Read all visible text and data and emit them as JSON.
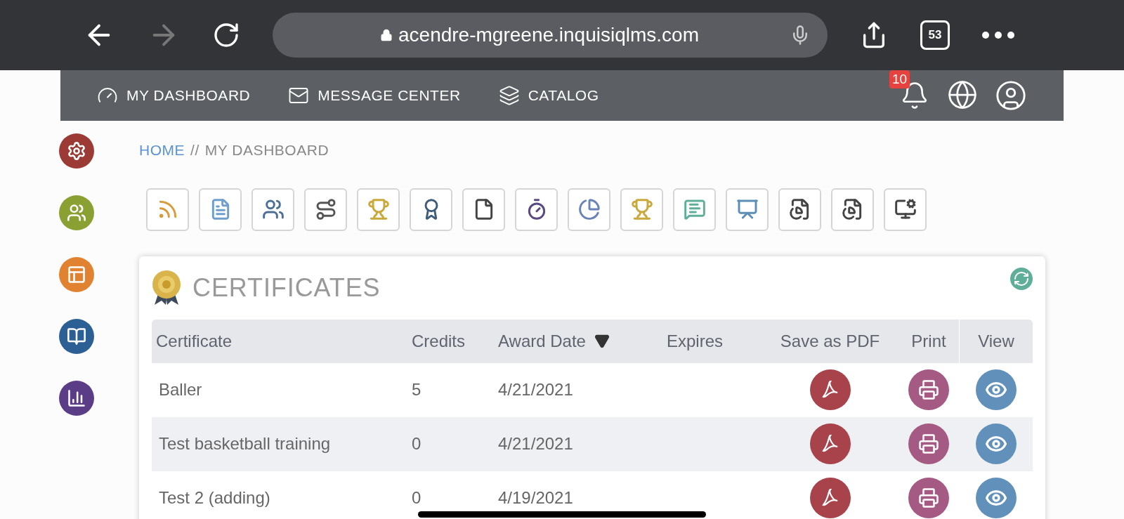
{
  "browser": {
    "url": "acendre-mgreene.inquisiqlms.com",
    "tab_count": "53",
    "forward_disabled": true
  },
  "nav": {
    "items": [
      {
        "label": "MY DASHBOARD",
        "kind": "dashboard"
      },
      {
        "label": "MESSAGE CENTER",
        "kind": "mail"
      },
      {
        "label": "CATALOG",
        "kind": "catalog"
      }
    ],
    "notification_count": "10"
  },
  "breadcrumb": {
    "home": "HOME",
    "separator": "//",
    "current": "MY DASHBOARD"
  },
  "widget": {
    "title": "CERTIFICATES",
    "columns": [
      {
        "label": "Certificate",
        "sorted": false
      },
      {
        "label": "Credits",
        "sorted": false
      },
      {
        "label": "Award Date",
        "sorted": true
      },
      {
        "label": "Expires",
        "sorted": false
      },
      {
        "label": "Save as PDF",
        "sorted": false
      },
      {
        "label": "Print",
        "sorted": false
      },
      {
        "label": "View",
        "sorted": false
      }
    ],
    "rows": [
      {
        "certificate": "Baller",
        "credits": "5",
        "award_date": "4/21/2021"
      },
      {
        "certificate": "Test basketball training",
        "credits": "0",
        "award_date": "4/21/2021"
      },
      {
        "certificate": "Test 2 (adding)",
        "credits": "0",
        "award_date": "4/19/2021"
      }
    ]
  }
}
